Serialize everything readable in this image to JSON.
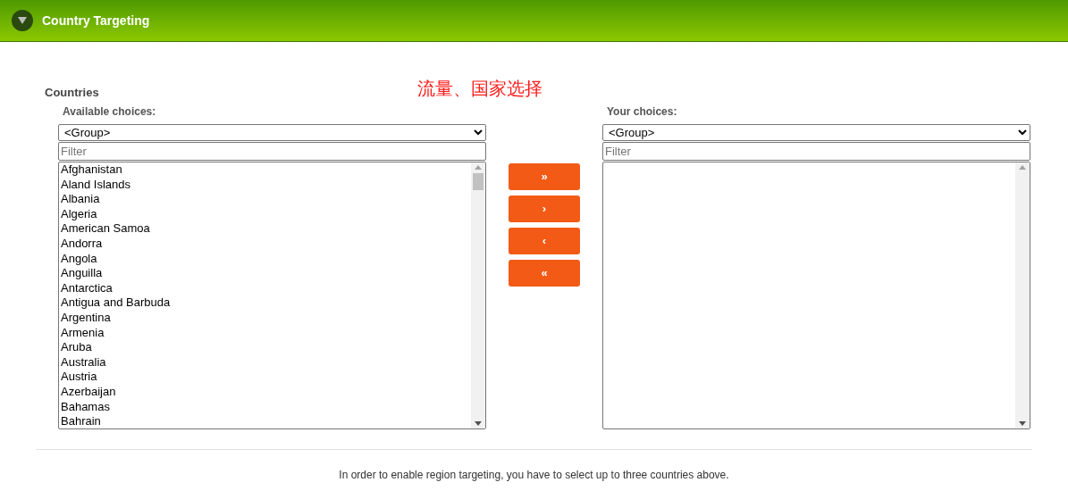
{
  "header": {
    "title": "Country Targeting"
  },
  "section": {
    "title": "Countries",
    "annotation": "流量、国家选择"
  },
  "available": {
    "label": "Available choices:",
    "group": "<Group>",
    "filter_placeholder": "Filter",
    "items": [
      "Afghanistan",
      "Aland Islands",
      "Albania",
      "Algeria",
      "American Samoa",
      "Andorra",
      "Angola",
      "Anguilla",
      "Antarctica",
      "Antigua and Barbuda",
      "Argentina",
      "Armenia",
      "Aruba",
      "Australia",
      "Austria",
      "Azerbaijan",
      "Bahamas",
      "Bahrain"
    ]
  },
  "move_buttons": [
    "»",
    "›",
    "‹",
    "«"
  ],
  "chosen": {
    "label": "Your choices:",
    "group": "<Group>",
    "filter_placeholder": "Filter"
  },
  "footer_note": "In order to enable region targeting, you have to select up to three countries above."
}
